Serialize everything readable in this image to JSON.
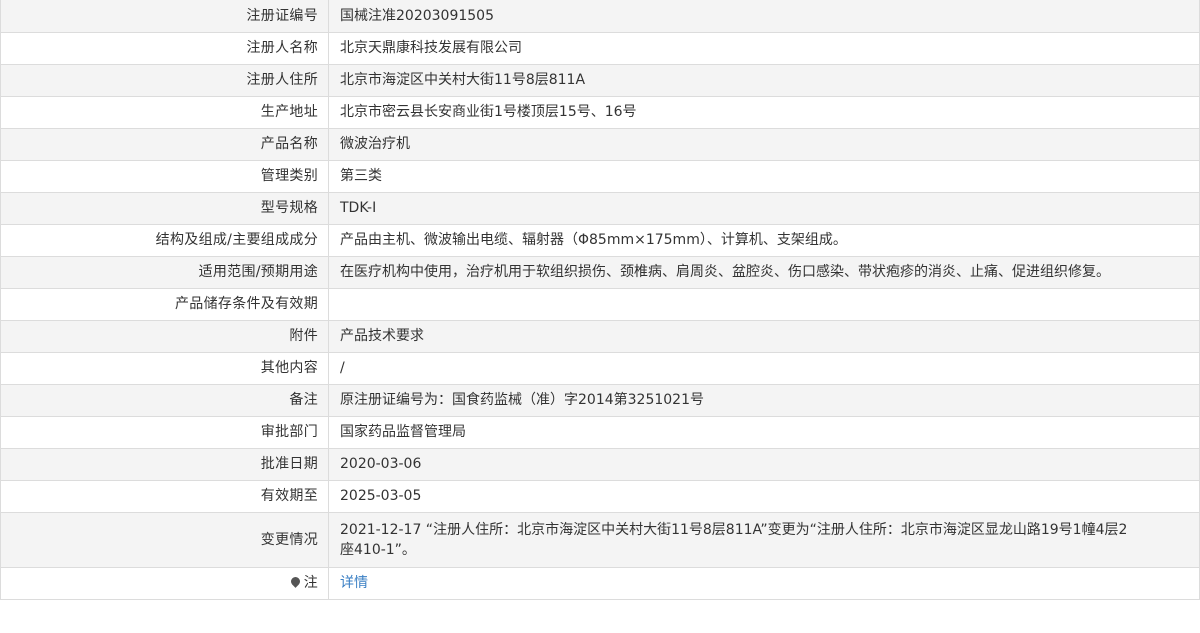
{
  "record": {
    "rows": [
      {
        "label": "注册证编号",
        "value": "国械注准20203091505"
      },
      {
        "label": "注册人名称",
        "value": "北京天鼎康科技发展有限公司"
      },
      {
        "label": "注册人住所",
        "value": "北京市海淀区中关村大街11号8层811A"
      },
      {
        "label": "生产地址",
        "value": "北京市密云县长安商业街1号楼顶层15号、16号"
      },
      {
        "label": "产品名称",
        "value": "微波治疗机"
      },
      {
        "label": "管理类别",
        "value": "第三类"
      },
      {
        "label": "型号规格",
        "value": "TDK-I"
      },
      {
        "label": "结构及组成/主要组成成分",
        "value": "产品由主机、微波输出电缆、辐射器（Φ85mm×175mm）、计算机、支架组成。"
      },
      {
        "label": "适用范围/预期用途",
        "value": "在医疗机构中使用，治疗机用于软组织损伤、颈椎病、肩周炎、盆腔炎、伤口感染、带状疱疹的消炎、止痛、促进组织修复。"
      },
      {
        "label": "产品储存条件及有效期",
        "value": ""
      },
      {
        "label": "附件",
        "value": "产品技术要求"
      },
      {
        "label": "其他内容",
        "value": "/"
      },
      {
        "label": "备注",
        "value": "原注册证编号为：国食药监械（准）字2014第3251021号"
      },
      {
        "label": "审批部门",
        "value": "国家药品监督管理局"
      },
      {
        "label": "批准日期",
        "value": "2020-03-06"
      },
      {
        "label": "有效期至",
        "value": "2025-03-05"
      },
      {
        "label": "变更情况",
        "value": "2021-12-17 “注册人住所：北京市海淀区中关村大街11号8层811A”变更为“注册人住所：北京市海淀区显龙山路19号1幢4层2座410-1”。"
      }
    ],
    "note": {
      "label": "注",
      "icon": "pin-icon",
      "link_text": "详情",
      "link_color": "#3a7fc4"
    }
  }
}
